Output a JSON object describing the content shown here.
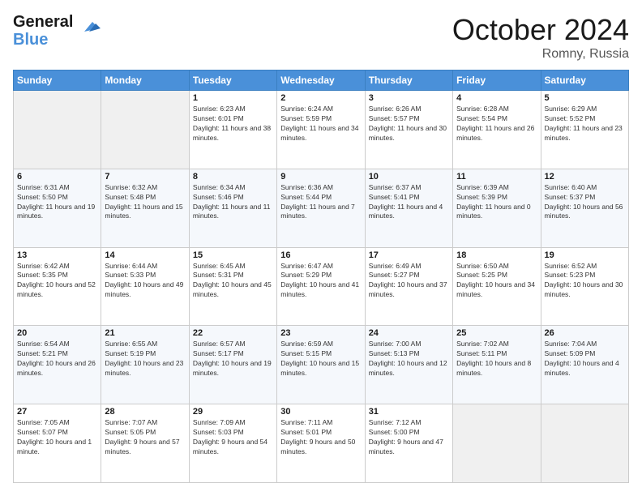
{
  "logo": {
    "line1": "General",
    "line2": "Blue"
  },
  "title": "October 2024",
  "location": "Romny, Russia",
  "days_of_week": [
    "Sunday",
    "Monday",
    "Tuesday",
    "Wednesday",
    "Thursday",
    "Friday",
    "Saturday"
  ],
  "weeks": [
    [
      {
        "num": "",
        "info": ""
      },
      {
        "num": "",
        "info": ""
      },
      {
        "num": "1",
        "info": "Sunrise: 6:23 AM\nSunset: 6:01 PM\nDaylight: 11 hours and 38 minutes."
      },
      {
        "num": "2",
        "info": "Sunrise: 6:24 AM\nSunset: 5:59 PM\nDaylight: 11 hours and 34 minutes."
      },
      {
        "num": "3",
        "info": "Sunrise: 6:26 AM\nSunset: 5:57 PM\nDaylight: 11 hours and 30 minutes."
      },
      {
        "num": "4",
        "info": "Sunrise: 6:28 AM\nSunset: 5:54 PM\nDaylight: 11 hours and 26 minutes."
      },
      {
        "num": "5",
        "info": "Sunrise: 6:29 AM\nSunset: 5:52 PM\nDaylight: 11 hours and 23 minutes."
      }
    ],
    [
      {
        "num": "6",
        "info": "Sunrise: 6:31 AM\nSunset: 5:50 PM\nDaylight: 11 hours and 19 minutes."
      },
      {
        "num": "7",
        "info": "Sunrise: 6:32 AM\nSunset: 5:48 PM\nDaylight: 11 hours and 15 minutes."
      },
      {
        "num": "8",
        "info": "Sunrise: 6:34 AM\nSunset: 5:46 PM\nDaylight: 11 hours and 11 minutes."
      },
      {
        "num": "9",
        "info": "Sunrise: 6:36 AM\nSunset: 5:44 PM\nDaylight: 11 hours and 7 minutes."
      },
      {
        "num": "10",
        "info": "Sunrise: 6:37 AM\nSunset: 5:41 PM\nDaylight: 11 hours and 4 minutes."
      },
      {
        "num": "11",
        "info": "Sunrise: 6:39 AM\nSunset: 5:39 PM\nDaylight: 11 hours and 0 minutes."
      },
      {
        "num": "12",
        "info": "Sunrise: 6:40 AM\nSunset: 5:37 PM\nDaylight: 10 hours and 56 minutes."
      }
    ],
    [
      {
        "num": "13",
        "info": "Sunrise: 6:42 AM\nSunset: 5:35 PM\nDaylight: 10 hours and 52 minutes."
      },
      {
        "num": "14",
        "info": "Sunrise: 6:44 AM\nSunset: 5:33 PM\nDaylight: 10 hours and 49 minutes."
      },
      {
        "num": "15",
        "info": "Sunrise: 6:45 AM\nSunset: 5:31 PM\nDaylight: 10 hours and 45 minutes."
      },
      {
        "num": "16",
        "info": "Sunrise: 6:47 AM\nSunset: 5:29 PM\nDaylight: 10 hours and 41 minutes."
      },
      {
        "num": "17",
        "info": "Sunrise: 6:49 AM\nSunset: 5:27 PM\nDaylight: 10 hours and 37 minutes."
      },
      {
        "num": "18",
        "info": "Sunrise: 6:50 AM\nSunset: 5:25 PM\nDaylight: 10 hours and 34 minutes."
      },
      {
        "num": "19",
        "info": "Sunrise: 6:52 AM\nSunset: 5:23 PM\nDaylight: 10 hours and 30 minutes."
      }
    ],
    [
      {
        "num": "20",
        "info": "Sunrise: 6:54 AM\nSunset: 5:21 PM\nDaylight: 10 hours and 26 minutes."
      },
      {
        "num": "21",
        "info": "Sunrise: 6:55 AM\nSunset: 5:19 PM\nDaylight: 10 hours and 23 minutes."
      },
      {
        "num": "22",
        "info": "Sunrise: 6:57 AM\nSunset: 5:17 PM\nDaylight: 10 hours and 19 minutes."
      },
      {
        "num": "23",
        "info": "Sunrise: 6:59 AM\nSunset: 5:15 PM\nDaylight: 10 hours and 15 minutes."
      },
      {
        "num": "24",
        "info": "Sunrise: 7:00 AM\nSunset: 5:13 PM\nDaylight: 10 hours and 12 minutes."
      },
      {
        "num": "25",
        "info": "Sunrise: 7:02 AM\nSunset: 5:11 PM\nDaylight: 10 hours and 8 minutes."
      },
      {
        "num": "26",
        "info": "Sunrise: 7:04 AM\nSunset: 5:09 PM\nDaylight: 10 hours and 4 minutes."
      }
    ],
    [
      {
        "num": "27",
        "info": "Sunrise: 7:05 AM\nSunset: 5:07 PM\nDaylight: 10 hours and 1 minute."
      },
      {
        "num": "28",
        "info": "Sunrise: 7:07 AM\nSunset: 5:05 PM\nDaylight: 9 hours and 57 minutes."
      },
      {
        "num": "29",
        "info": "Sunrise: 7:09 AM\nSunset: 5:03 PM\nDaylight: 9 hours and 54 minutes."
      },
      {
        "num": "30",
        "info": "Sunrise: 7:11 AM\nSunset: 5:01 PM\nDaylight: 9 hours and 50 minutes."
      },
      {
        "num": "31",
        "info": "Sunrise: 7:12 AM\nSunset: 5:00 PM\nDaylight: 9 hours and 47 minutes."
      },
      {
        "num": "",
        "info": ""
      },
      {
        "num": "",
        "info": ""
      }
    ]
  ]
}
